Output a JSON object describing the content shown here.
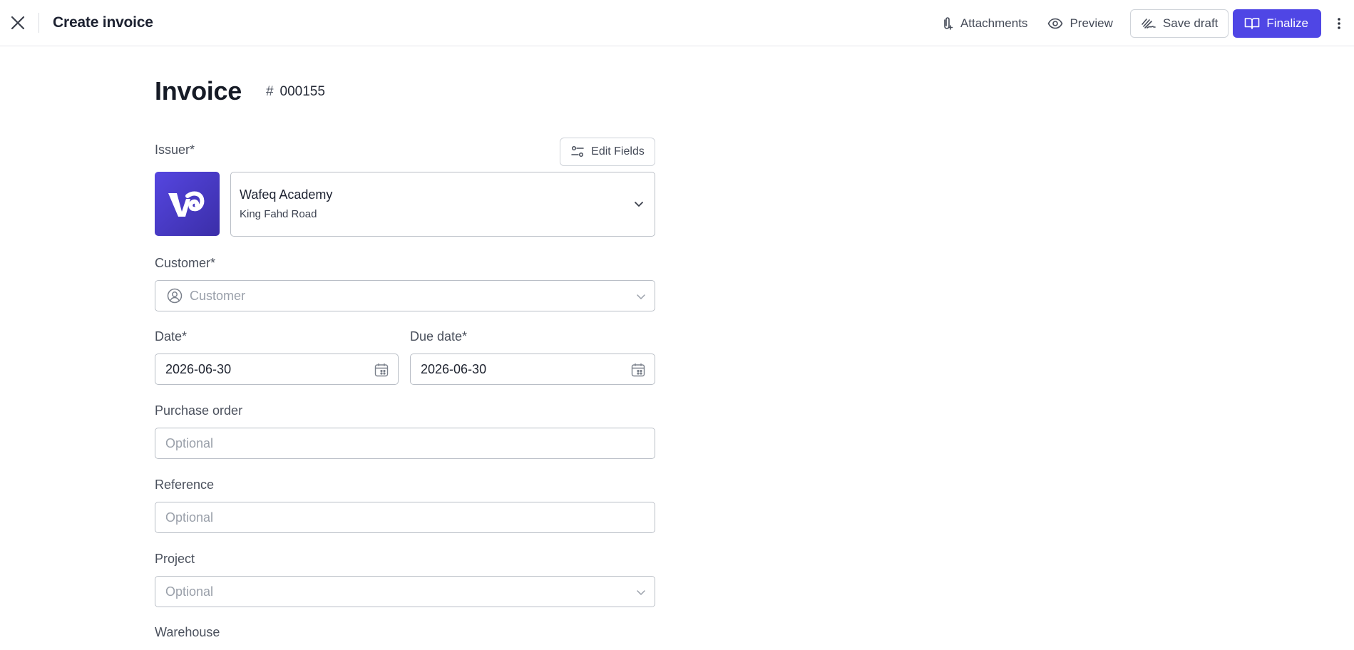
{
  "header": {
    "title": "Create invoice",
    "attachments_label": "Attachments",
    "preview_label": "Preview",
    "save_draft_label": "Save draft",
    "finalize_label": "Finalize",
    "accent_color": "#4f46e5"
  },
  "invoice": {
    "title": "Invoice",
    "number_prefix": "#",
    "number": "000155"
  },
  "issuer": {
    "label": "Issuer*",
    "edit_fields_label": "Edit Fields",
    "name": "Wafeq Academy",
    "address": "King Fahd Road"
  },
  "customer": {
    "label": "Customer*",
    "placeholder": "Customer"
  },
  "date": {
    "label": "Date*",
    "value": "2026-06-30"
  },
  "due_date": {
    "label": "Due date*",
    "value": "2026-06-30"
  },
  "purchase_order": {
    "label": "Purchase order",
    "placeholder": "Optional"
  },
  "reference": {
    "label": "Reference",
    "placeholder": "Optional"
  },
  "project": {
    "label": "Project",
    "placeholder": "Optional"
  },
  "warehouse": {
    "label": "Warehouse"
  }
}
